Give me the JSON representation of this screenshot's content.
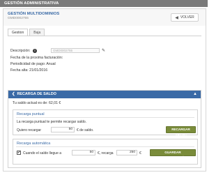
{
  "header": {
    "title": "GESTIÓN ADMINISTRATIVA"
  },
  "service": {
    "title": "GESTIÓN MULTIDOMINIOS",
    "code": "GMD0002755",
    "back_label": "VOLVER"
  },
  "tabs": [
    {
      "label": "Gestion"
    },
    {
      "label": "Baja"
    }
  ],
  "details": {
    "description_label": "Descripción:",
    "description_value": "GMD0002755",
    "next_billing_label": "Fecha de la proxima facturación:",
    "periodicity_label": "Periodicidad de pago:",
    "periodicity_value": "Anual",
    "start_date_label": "Fecha alta:",
    "start_date_value": "21/01/2016"
  },
  "recharge": {
    "title": "RECARGA DE SALDO",
    "balance_text": "Tu saldo actual es de: 62,01 €",
    "punctual": {
      "title": "Recarga puntual",
      "description": "La recarga puntual te permite recargar saldo.",
      "prefix": "Quiero recargar",
      "amount": "50",
      "suffix": "€ de saldo.",
      "button": "RECARGAR SALDO"
    },
    "automatic": {
      "title": "Recarga automática",
      "checked": "✔",
      "prefix": "Cuando el saldo llegue a",
      "threshold": "50",
      "middle": "€, recarga",
      "amount": "250",
      "suffix": "€",
      "button": "GUARDAR CONFIGURACIÓN"
    }
  },
  "colors": {
    "accent": "#3a6aa6",
    "button": "#7a8c3a",
    "topbar": "#7a7a7a"
  }
}
